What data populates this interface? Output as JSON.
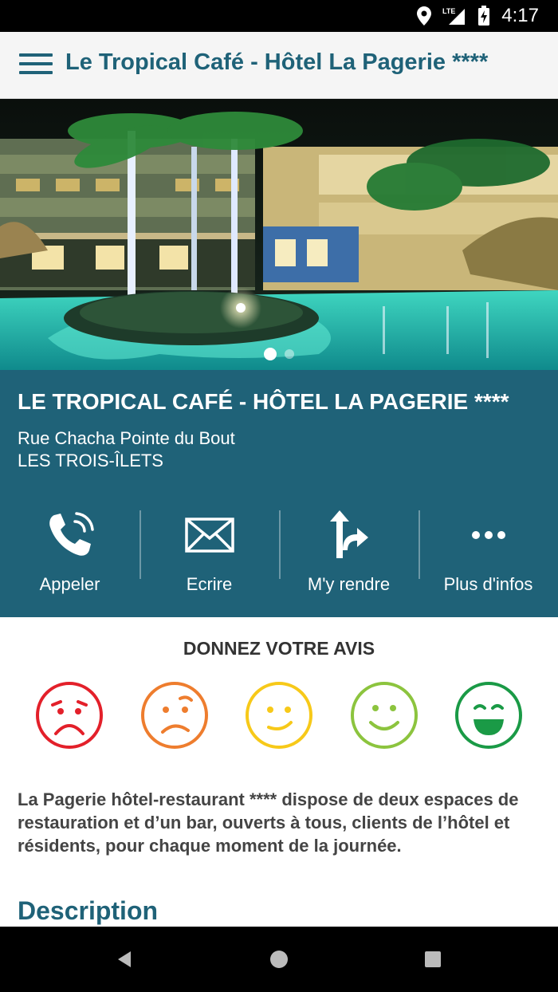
{
  "status_bar": {
    "time": "4:17",
    "network": "LTE",
    "icons": [
      "location-icon",
      "signal-icon",
      "battery-charging-icon"
    ]
  },
  "app_bar": {
    "title": "Le Tropical Café - Hôtel La Pagerie ****",
    "menu_icon": "hamburger-icon"
  },
  "carousel": {
    "slide_count": 2,
    "active_slide": 1
  },
  "place": {
    "title": "LE TROPICAL CAFÉ - HÔTEL LA PAGERIE ****",
    "address_line1": "Rue Chacha Pointe du Bout",
    "address_line2": "LES TROIS-ÎLETS"
  },
  "actions": [
    {
      "label": "Appeler",
      "icon": "phone-icon"
    },
    {
      "label": "Ecrire",
      "icon": "envelope-icon"
    },
    {
      "label": "M'y rendre",
      "icon": "directions-icon"
    },
    {
      "label": "Plus d'infos",
      "icon": "more-icon"
    }
  ],
  "rating": {
    "title": "DONNEZ VOTRE AVIS",
    "options": [
      {
        "name": "very-unhappy",
        "color": "#e3202a"
      },
      {
        "name": "unhappy",
        "color": "#ee7d2e"
      },
      {
        "name": "neutral",
        "color": "#f7c919"
      },
      {
        "name": "happy",
        "color": "#8cc43e"
      },
      {
        "name": "very-happy",
        "color": "#1a9a46"
      }
    ]
  },
  "description": {
    "intro": "La Pagerie hôtel-restaurant **** dispose de deux espaces de restauration et d’un bar, ouverts à tous, clients de l’hôtel et résidents, pour chaque moment de la journée.",
    "section_title": "Description"
  },
  "colors": {
    "primary": "#1f6278",
    "app_bar_bg": "#f5f5f5"
  }
}
